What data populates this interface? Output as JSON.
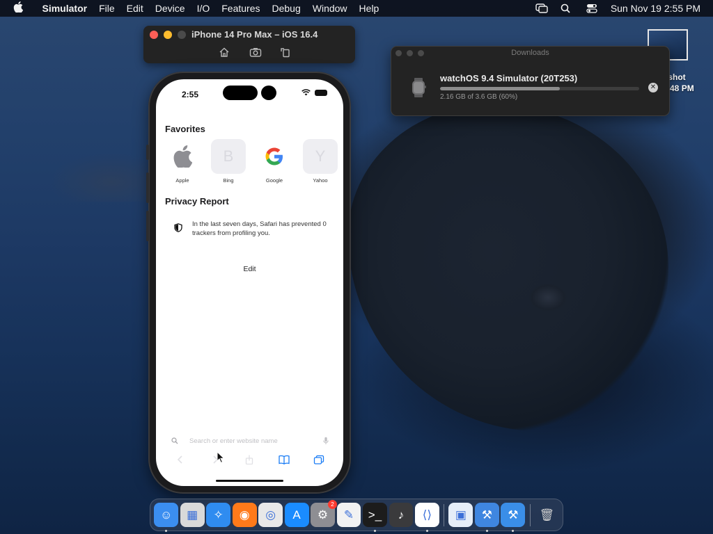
{
  "menubar": {
    "app_name": "Simulator",
    "items": [
      "File",
      "Edit",
      "Device",
      "I/O",
      "Features",
      "Debug",
      "Window",
      "Help"
    ],
    "clock": "Sun Nov 19  2:55 PM"
  },
  "simulator": {
    "window_title": "iPhone 14 Pro Max – iOS 16.4"
  },
  "phone": {
    "status_time": "2:55",
    "favorites_title": "Favorites",
    "favorites": [
      {
        "label": "Apple",
        "glyph": ""
      },
      {
        "label": "Bing",
        "glyph": "B"
      },
      {
        "label": "Google",
        "glyph": "G"
      },
      {
        "label": "Yahoo",
        "glyph": "Y"
      }
    ],
    "privacy_title": "Privacy Report",
    "privacy_text": "In the last seven days, Safari has prevented 0 trackers from profiling you.",
    "edit_label": "Edit",
    "search_placeholder": "Search or enter website name"
  },
  "downloads": {
    "window_title": "Downloads",
    "item_name": "watchOS 9.4 Simulator (20T253)",
    "progress_text": "2.16 GB of 3.6 GB (60%)",
    "progress_fraction": 0.6
  },
  "desktop": {
    "file_label_line1": "nshot",
    "file_label_line2": "3.48 PM"
  },
  "dock": {
    "apps": [
      {
        "name": "finder",
        "color": "#3b8ef0",
        "glyph": "☺"
      },
      {
        "name": "launchpad",
        "color": "#d9d9d9",
        "glyph": "▦"
      },
      {
        "name": "safari",
        "color": "#2f8cf0",
        "glyph": "✧"
      },
      {
        "name": "firefox",
        "color": "#ff7a1a",
        "glyph": "◉"
      },
      {
        "name": "chrome",
        "color": "#e8e8e8",
        "glyph": "◎"
      },
      {
        "name": "app-store",
        "color": "#1a8cff",
        "glyph": "A"
      },
      {
        "name": "system-settings",
        "color": "#8e8e93",
        "glyph": "⚙",
        "badge": "2"
      },
      {
        "name": "textedit",
        "color": "#f2f2f2",
        "glyph": "✎"
      },
      {
        "name": "terminal",
        "color": "#1c1c1c",
        "glyph": ">_"
      },
      {
        "name": "garageband",
        "color": "#3a3a3c",
        "glyph": "♪"
      },
      {
        "name": "vscode",
        "color": "#ffffff",
        "glyph": "⟨⟩"
      },
      {
        "name": "preview",
        "color": "#e6eef8",
        "glyph": "▣"
      },
      {
        "name": "xcode",
        "color": "#3f86e0",
        "glyph": "⚒"
      },
      {
        "name": "simulator",
        "color": "#3a8ee8",
        "glyph": "⚒"
      },
      {
        "name": "trash",
        "color": "rgba(0,0,0,0)",
        "glyph": "🗑"
      }
    ]
  }
}
